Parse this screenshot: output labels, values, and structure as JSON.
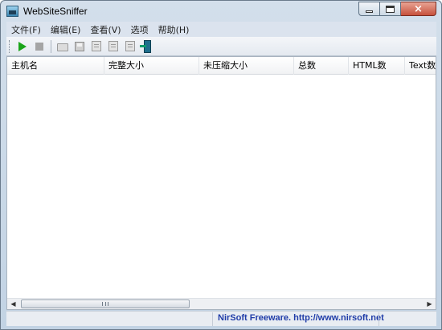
{
  "window": {
    "title": "WebSiteSniffer",
    "icon": "app-icon"
  },
  "caption_buttons": {
    "minimize": "minimize-icon",
    "maximize": "maximize-icon",
    "close": "×"
  },
  "menu": [
    {
      "label": "文件(F)"
    },
    {
      "label": "编辑(E)"
    },
    {
      "label": "查看(V)"
    },
    {
      "label": "选项"
    },
    {
      "label": "帮助(H)"
    }
  ],
  "toolbar": {
    "buttons": [
      "play-icon",
      "stop-icon",
      "open-folder-icon",
      "save-icon",
      "copy-icon",
      "properties-icon",
      "find-icon",
      "exit-icon"
    ]
  },
  "table": {
    "columns": [
      {
        "label": "主机名"
      },
      {
        "label": "完整大小"
      },
      {
        "label": "未压缩大小"
      },
      {
        "label": "总数"
      },
      {
        "label": "HTML数"
      },
      {
        "label": "Text数"
      }
    ],
    "rows": []
  },
  "scrollbar": {
    "left_arrow": "◀",
    "right_arrow": "▶"
  },
  "status": {
    "left_text": "",
    "link_text": "NirSoft Freeware.  http://www.nirsoft.net",
    "link_color": "#1f3ca8"
  }
}
